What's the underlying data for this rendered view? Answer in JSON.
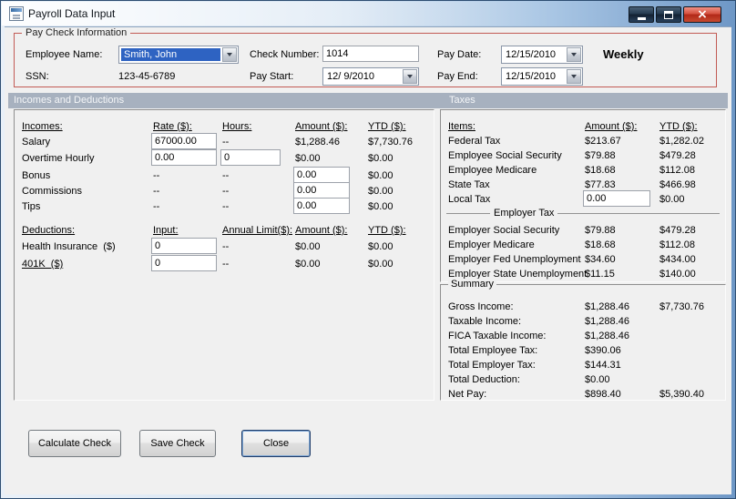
{
  "window": {
    "title": "Payroll Data Input"
  },
  "colors": {
    "group_border": "#c25b55",
    "band_bg": "#a7b1bf",
    "selection_bg": "#2e63c2",
    "close_button_red": "#b12718",
    "client_bg": "#f0f0f0"
  },
  "paycheck": {
    "group_label": "Pay Check Information",
    "employee_name": {
      "label": "Employee Name:",
      "value": "Smith, John"
    },
    "ssn": {
      "label": "SSN:",
      "value": "123-45-6789"
    },
    "check_number": {
      "label": "Check Number:",
      "value": "1014"
    },
    "pay_start": {
      "label": "Pay Start:",
      "value": "12/ 9/2010"
    },
    "pay_date": {
      "label": "Pay Date:",
      "value": "12/15/2010"
    },
    "pay_end": {
      "label": "Pay End:",
      "value": "12/15/2010"
    },
    "frequency": "Weekly"
  },
  "sections": {
    "incomes_header": "Incomes and Deductions",
    "taxes_header": "Taxes"
  },
  "incomes": {
    "headers": [
      "Incomes:",
      "Rate ($):",
      "Hours:",
      "Amount ($):",
      "YTD ($):"
    ],
    "rows": [
      {
        "name": "Salary",
        "rate": "67000.00",
        "hours": "--",
        "amount": "$1,288.46",
        "ytd": "$7,730.76"
      },
      {
        "name": "Overtime Hourly",
        "rate": "0.00",
        "hours": "0",
        "amount": "$0.00",
        "ytd": "$0.00"
      },
      {
        "name": "Bonus",
        "rate": "--",
        "hours": "--",
        "amount": "0.00",
        "ytd": "$0.00"
      },
      {
        "name": "Commissions",
        "rate": "--",
        "hours": "--",
        "amount": "0.00",
        "ytd": "$0.00"
      },
      {
        "name": "Tips",
        "rate": "--",
        "hours": "--",
        "amount": "0.00",
        "ytd": "$0.00"
      }
    ]
  },
  "deductions": {
    "headers": [
      "Deductions:",
      "Input:",
      "Annual Limit($):",
      "Amount ($):",
      "YTD ($):"
    ],
    "rows": [
      {
        "name": "Health Insurance  ($)",
        "input": "0",
        "limit": "--",
        "amount": "$0.00",
        "ytd": "$0.00"
      },
      {
        "name": "401K  ($)",
        "input": "0",
        "limit": "--",
        "amount": "$0.00",
        "ytd": "$0.00"
      }
    ]
  },
  "taxes": {
    "headers": [
      "Items:",
      "Amount ($):",
      "YTD ($):"
    ],
    "employee_rows": [
      {
        "name": "Federal Tax",
        "amount": "$213.67",
        "ytd": "$1,282.02"
      },
      {
        "name": "Employee Social Security",
        "amount": "$79.88",
        "ytd": "$479.28"
      },
      {
        "name": "Employee Medicare",
        "amount": "$18.68",
        "ytd": "$112.08"
      },
      {
        "name": "State Tax",
        "amount": "$77.83",
        "ytd": "$466.98"
      },
      {
        "name": "Local Tax",
        "amount": "0.00",
        "ytd": "$0.00"
      }
    ],
    "employer_separator": "Employer Tax",
    "employer_rows": [
      {
        "name": "Employer Social Security",
        "amount": "$79.88",
        "ytd": "$479.28"
      },
      {
        "name": "Employer Medicare",
        "amount": "$18.68",
        "ytd": "$112.08"
      },
      {
        "name": "Employer Fed Unemployment",
        "amount": "$34.60",
        "ytd": "$434.00"
      },
      {
        "name": "Employer State Unemployment",
        "amount": "$11.15",
        "ytd": "$140.00"
      }
    ]
  },
  "summary": {
    "header": "Summary",
    "rows": [
      {
        "name": "Gross Income:",
        "amount": "$1,288.46",
        "ytd": "$7,730.76"
      },
      {
        "name": "Taxable Income:",
        "amount": "$1,288.46",
        "ytd": ""
      },
      {
        "name": "FICA Taxable Income:",
        "amount": "$1,288.46",
        "ytd": ""
      },
      {
        "name": "Total Employee Tax:",
        "amount": "$390.06",
        "ytd": ""
      },
      {
        "name": "Total Employer Tax:",
        "amount": "$144.31",
        "ytd": ""
      },
      {
        "name": "Total Deduction:",
        "amount": "$0.00",
        "ytd": ""
      },
      {
        "name": "Net Pay:",
        "amount": "$898.40",
        "ytd": "$5,390.40"
      }
    ]
  },
  "buttons": {
    "calculate": "Calculate Check",
    "save": "Save Check",
    "close": "Close"
  }
}
